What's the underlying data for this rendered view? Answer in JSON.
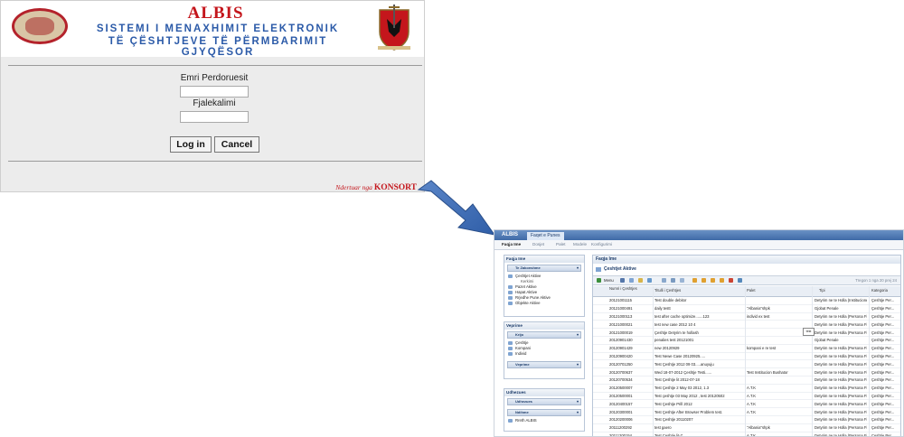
{
  "login": {
    "brand": "ALBIS",
    "system_line1": "SISTEMI I MENAXHIMIT ELEKTRONIK",
    "system_line2": "TË ÇËSHTJEVE TË PËRMBARIMIT GJYQËSOR",
    "username_label": "Emri Perdoruesit",
    "username_value": "",
    "password_label": "Fjalekalimi",
    "password_value": "",
    "login_button": "Log in",
    "cancel_button": "Cancel",
    "credit_prefix": "Ndertuar nga",
    "credit_company": "KONSORT",
    "colors": {
      "brand": "#c4161c",
      "system_text": "#2b5aa8",
      "panel": "#ececec"
    }
  },
  "app": {
    "logo": "ALBIS",
    "top_tab": "Faqet e Punes",
    "menu": [
      "Faqja Ime",
      "Dosjet",
      "Palet",
      "Modele",
      "Konfigurimi"
    ],
    "sidebar": {
      "box1_title": "Faqja Ime",
      "box1_bar": "Te Zakonshme",
      "box1_items": [
        {
          "label": "Çeshtjet Aktive",
          "sub": false
        },
        {
          "label": "Kerkimi",
          "sub": true
        },
        {
          "label": "Pazet Aktive",
          "sub": false
        },
        {
          "label": "Hapat Aktive",
          "sub": false
        },
        {
          "label": "Rrjedhe Pune Aktive",
          "sub": false
        },
        {
          "label": "Objekte Aktive",
          "sub": false
        }
      ],
      "box2_title": "Veprime",
      "box2_bar1": "Krijo",
      "box2_items": [
        "Çeshtje",
        "Kompani",
        "Individ"
      ],
      "box2_bar2": "Veprime",
      "box3_title": "Udhezues",
      "box3_bar1": "Udhezues",
      "box3_bar2": "Ndihme",
      "box3_items": [
        "Rreth ALBIS"
      ]
    },
    "main": {
      "title": "Faqja Ime",
      "subtitle": "Çeshtjet Aktive",
      "toolbar_menu": "Menu",
      "paging": "Tregon 1 nga 20 prej 24",
      "columns": [
        "Numri i Çeshtjes",
        "Titulli i Çeshtjes",
        "Palet",
        "Tipi",
        "Kategoria"
      ],
      "rows": [
        [
          "20121001115",
          "Test double debitor",
          "",
          "Detyrim ne te Holla (Institucionet ...",
          "Çeshtje Per..."
        ],
        [
          "20121000491",
          "daily testt",
          "\"Albania\"shpk",
          "Gjobat Penale",
          "Çeshtje Per..."
        ],
        [
          "20121000113",
          "test after cache optimize.......123",
          "individ ex test",
          "Detyrim ne te Holla (Persona Fiz...",
          "Çeshtje Per..."
        ],
        [
          "20121000021",
          "test new case 2012 10 4",
          "",
          "Detyrim ne te Holla (Persona Fiz...",
          "Çeshtje Per..."
        ],
        [
          "20121000019",
          "Çeshtje Detyrim te hollash",
          "",
          "Detyrim ne te Holla (Persona Fiz...",
          "Çeshtje Per..."
        ],
        [
          "20120901430",
          "penalies test 20121001",
          "",
          "Gjobat Penale",
          "Çeshtje Per..."
        ],
        [
          "20120901429",
          "new 20120929",
          "kompani e re test",
          "Detyrim ne te Holla (Persona Fiz...",
          "Çeshtje Per..."
        ],
        [
          "20120900420",
          "Test Newe Case 20120925.....",
          "",
          "Detyrim ne te Holla (Persona Fiz...",
          "Çeshtje Per..."
        ],
        [
          "20120701250",
          "Test Çeshtje 2012 09 03.....anuyuju",
          "",
          "Detyrim ne te Holla (Persona Fiz...",
          "Çeshtje Per..."
        ],
        [
          "20120700637",
          "Wed 18-07-2012 Çeshtje Testi......",
          "Test Institucion Bushator",
          "Detyrim ne te Holla (Persona Fiz...",
          "Çeshtje Per..."
        ],
        [
          "20120700534",
          "Test Çeshtje lit 2012-07-18",
          "",
          "Detyrim ne te Holla (Persona Fiz...",
          "Çeshtje Per..."
        ],
        [
          "20120500007",
          "Test Çeshtje 2 May 03 2012, 1.3",
          "A.T.K",
          "Detyrim ne te Holla (Persona Fiz...",
          "Çeshtje Per..."
        ],
        [
          "20120500001",
          "Test çeshtje 03 May 2012 , test 20120502",
          "A.T.K",
          "Detyrim ne te Holla (Persona Fiz...",
          "Çeshtje Per..."
        ],
        [
          "20120400157",
          "Test Çeshtje Prill 2012",
          "A.T.K",
          "Detyrim ne te Holla (Persona Fiz...",
          "Çeshtje Per..."
        ],
        [
          "20120300001",
          "Test Çeshtje After Browser Problem test.",
          "A.T.K",
          "Detyrim ne te Holla (Persona Fiz...",
          "Çeshtje Per..."
        ],
        [
          "20120200006",
          "Test Çeshtje 20110207",
          "",
          "Detyrim ne te Holla (Persona Fiz...",
          "Çeshtje Per..."
        ],
        [
          "20111200292",
          "test gaero",
          "\"Albania\"shpk",
          "Detyrim ne te Holla (Persona Fiz...",
          "Çeshtje Per..."
        ],
        [
          "20111200154",
          "Test Çeshtje lit-7",
          "A.T.K",
          "Detyrim ne te Holla (Persona Fiz...",
          "Çeshtje Per..."
        ],
        [
          "20111100203",
          "Test Çeshtje lit-lit test",
          "A.T.K",
          "Detyrim ne te Holla (Persona Fiz...",
          "Çeshtje Per..."
        ],
        [
          "20111100111",
          "Test Çeshtje lit-lit",
          "",
          "Detyrim ne te Holla (Persona Fiz...",
          "Çeshtje Per..."
        ]
      ],
      "tooltip": "test",
      "colors": {
        "header": "#3f6aa7",
        "accent": "#7fa4d2"
      }
    }
  }
}
